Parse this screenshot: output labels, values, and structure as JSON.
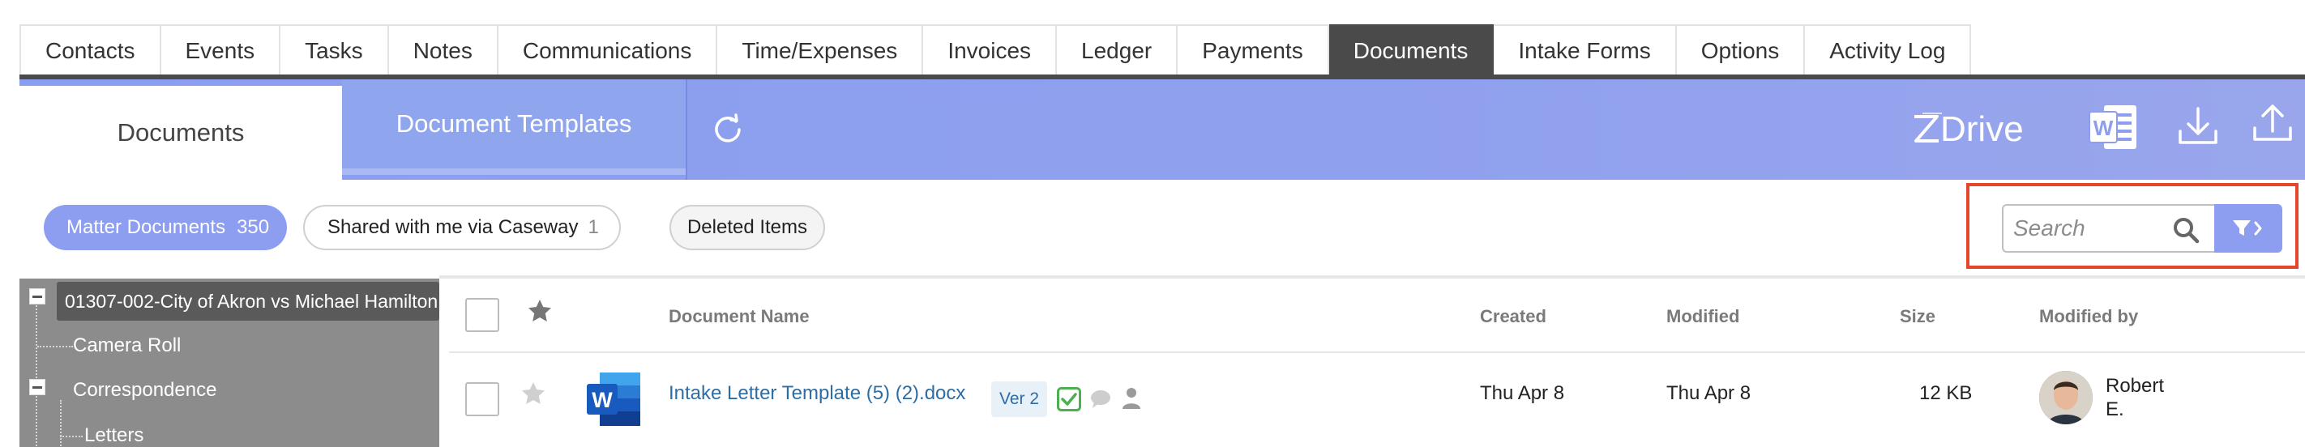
{
  "top_tabs": [
    {
      "label": "Contacts",
      "active": false
    },
    {
      "label": "Events",
      "active": false
    },
    {
      "label": "Tasks",
      "active": false
    },
    {
      "label": "Notes",
      "active": false
    },
    {
      "label": "Communications",
      "active": false
    },
    {
      "label": "Time/Expenses",
      "active": false
    },
    {
      "label": "Invoices",
      "active": false
    },
    {
      "label": "Ledger",
      "active": false
    },
    {
      "label": "Payments",
      "active": false
    },
    {
      "label": "Documents",
      "active": true
    },
    {
      "label": "Intake Forms",
      "active": false
    },
    {
      "label": "Options",
      "active": false
    },
    {
      "label": "Activity Log",
      "active": false
    }
  ],
  "header": {
    "tab_documents": "Documents",
    "tab_templates": "Document Templates",
    "brand": "zDrive",
    "icons": [
      "refresh-icon",
      "word-icon",
      "download-icon",
      "upload-icon"
    ]
  },
  "filters": {
    "matter_documents_label": "Matter Documents",
    "matter_documents_count": "350",
    "shared_label": "Shared with me via Caseway",
    "shared_count": "1",
    "deleted_label": "Deleted Items",
    "search_placeholder": "Search"
  },
  "tree": {
    "root": "01307-002-City of Akron vs Michael Hamilton",
    "items": [
      "Camera Roll",
      "Correspondence",
      "Letters"
    ]
  },
  "table": {
    "headers": {
      "name": "Document Name",
      "created": "Created",
      "modified": "Modified",
      "size": "Size",
      "modified_by": "Modified by"
    },
    "rows": [
      {
        "name": "Intake Letter Template (5) (2).docx",
        "version": "Ver 2",
        "created": "Thu Apr 8",
        "modified": "Thu Apr 8",
        "size": "12 KB",
        "modified_by": "Robert E."
      }
    ]
  },
  "colors": {
    "accent": "#8d9ef0",
    "active_tab": "#4a4a4a",
    "highlight": "#e5442d",
    "link": "#2e6da4"
  }
}
